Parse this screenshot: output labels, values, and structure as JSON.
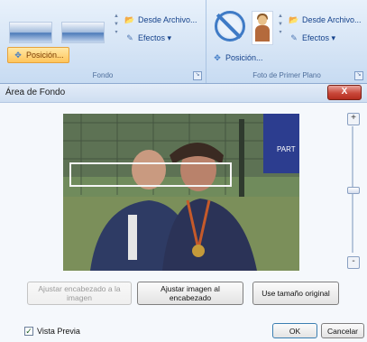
{
  "ribbon": {
    "fondo": {
      "desde_archivo": "Desde Archivo...",
      "efectos": "Efectos",
      "posicion": "Posición...",
      "group_label": "Fondo"
    },
    "primer_plano": {
      "desde_archivo": "Desde Archivo...",
      "efectos": "Efectos",
      "posicion": "Posición...",
      "group_label": "Foto de Primer Plano"
    }
  },
  "dialog": {
    "title": "Área de Fondo",
    "close_glyph": "X",
    "buttons": {
      "ajustar_encabezado": "Ajustar encabezado a la imagen",
      "ajustar_imagen": "Ajustar imagen al encabezado",
      "tamano_original": "Use tamaño original",
      "ok": "OK",
      "cancel": "Cancelar"
    },
    "vista_previa": {
      "label": "Vista Previa",
      "checked": true
    },
    "zoom_in": "+",
    "zoom_out": "-",
    "photo_banner_text": "PART"
  },
  "icons": [
    "folder-icon",
    "effects-icon",
    "position-icon",
    "no-image-icon",
    "person-photo-icon",
    "dialog-launcher-icon",
    "close-icon"
  ],
  "colors": {
    "ribbon_text": "#15428b",
    "selected": "#ffc55c",
    "close": "#c9483a"
  }
}
